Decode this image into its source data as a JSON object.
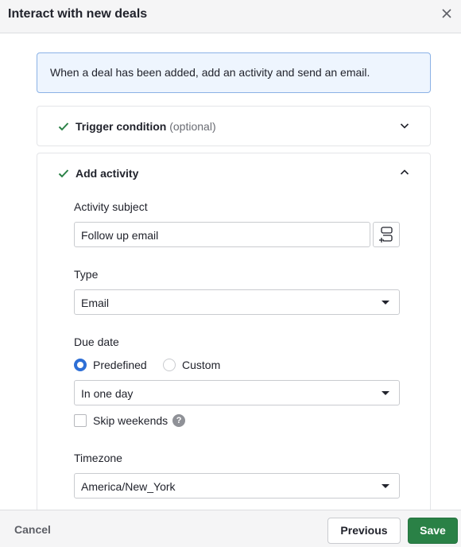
{
  "dialog": {
    "title": "Interact with new deals",
    "close_icon": "close-icon"
  },
  "info_banner": {
    "text": "When a deal has been added, add an activity and send an email."
  },
  "steps": [
    {
      "title": "Trigger condition",
      "suffix": "(optional)",
      "status_icon": "check-icon",
      "expanded": false
    },
    {
      "title": "Add activity",
      "status_icon": "check-icon",
      "expanded": true
    }
  ],
  "activity_form": {
    "subject": {
      "label": "Activity subject",
      "value": "Follow up email",
      "insert_field_icon": "insert-field-icon"
    },
    "type": {
      "label": "Type",
      "selected": "Email"
    },
    "due_date": {
      "label": "Due date",
      "options": [
        {
          "label": "Predefined",
          "checked": true
        },
        {
          "label": "Custom",
          "checked": false
        }
      ],
      "selected": "In one day",
      "skip_weekends": {
        "label": "Skip weekends",
        "checked": false,
        "help_icon": "?"
      }
    },
    "timezone": {
      "label": "Timezone",
      "selected": "America/New_York"
    }
  },
  "footer": {
    "cancel_label": "Cancel",
    "previous_label": "Previous",
    "save_label": "Save"
  },
  "colors": {
    "accent_green": "#2a8146",
    "radio_blue": "#2e6fd6",
    "info_bg": "#eef5fe",
    "info_border": "#8bb2e6"
  }
}
